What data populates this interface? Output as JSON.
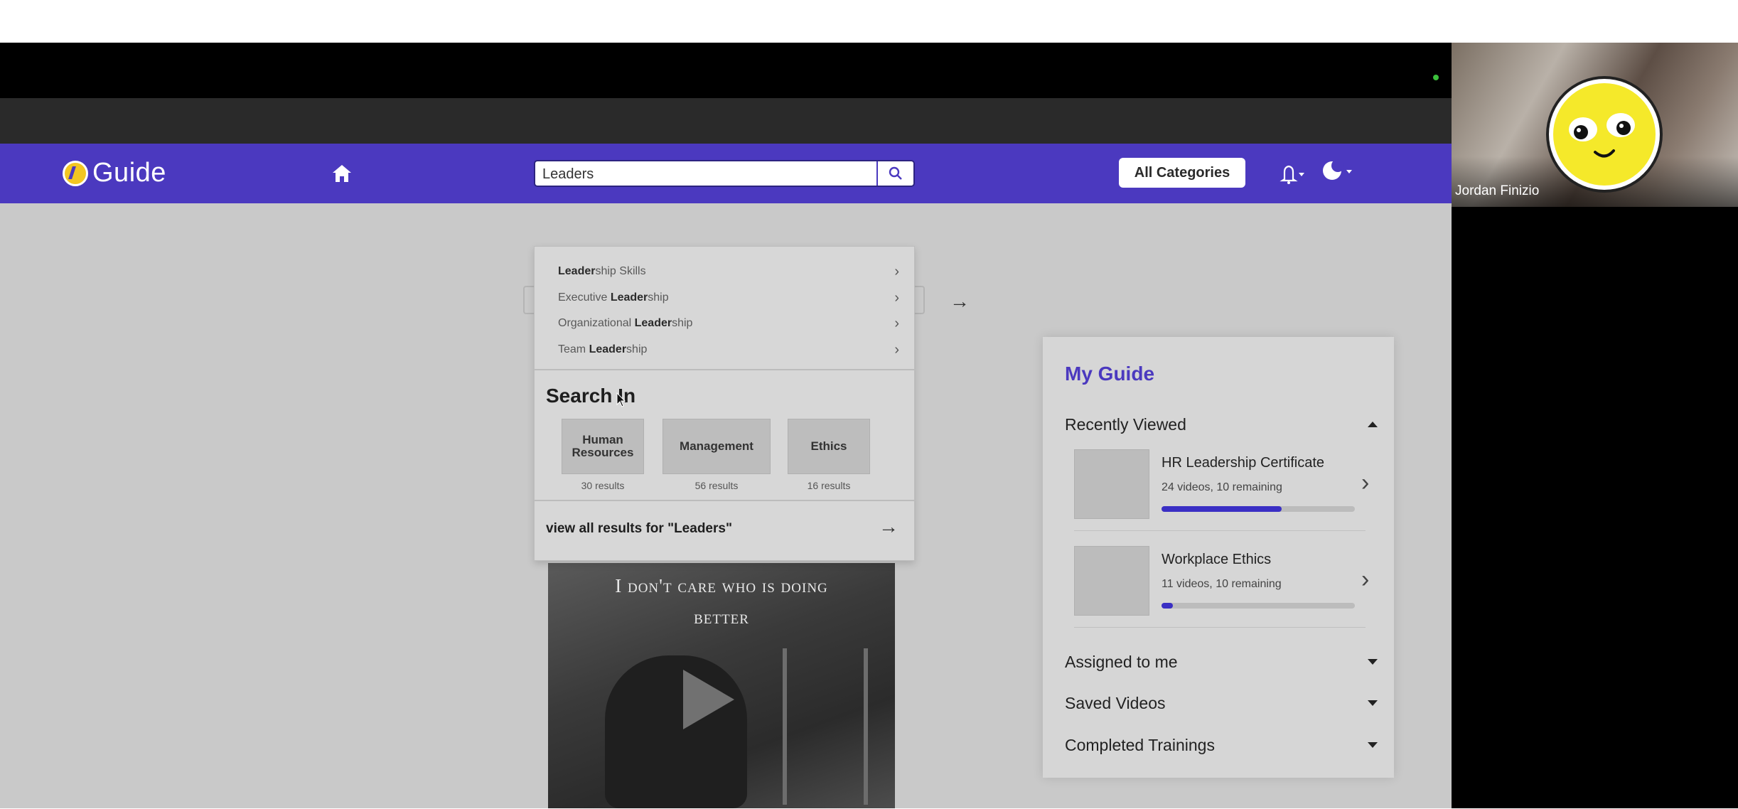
{
  "nav": {
    "logo_text": "Guide",
    "search_value": "Leaders",
    "all_categories_label": "All Categories"
  },
  "suggestions": [
    {
      "bold": "Leader",
      "rest": "ship Skills",
      "pre": ""
    },
    {
      "pre": "Executive ",
      "bold": "Leader",
      "rest": "ship"
    },
    {
      "pre": "Organizational ",
      "bold": "Leader",
      "rest": "ship"
    },
    {
      "pre": "Team ",
      "bold": "Leader",
      "rest": "ship"
    }
  ],
  "search_in": {
    "title": "Search In",
    "categories": [
      {
        "label_line1": "Human",
        "label_line2": "Resources",
        "count": "30 results"
      },
      {
        "label_line1": "Management",
        "label_line2": "",
        "count": "56 results"
      },
      {
        "label_line1": "Ethics",
        "label_line2": "",
        "count": "16 results"
      }
    ],
    "view_all": "view all results for \"Leaders\""
  },
  "video": {
    "caption_line1": "I don't care who is doing",
    "caption_line2": "better"
  },
  "my_guide": {
    "title": "My Guide",
    "recently_viewed": "Recently Viewed",
    "items": [
      {
        "title": "HR Leadership Certificate",
        "subtitle": "24 videos, 10 remaining",
        "progress": 0.62
      },
      {
        "title": "Workplace Ethics",
        "subtitle": "11 videos, 10 remaining",
        "progress": 0.06
      }
    ],
    "assigned": "Assigned to me",
    "saved": "Saved Videos",
    "completed": "Completed Trainings"
  },
  "participant": {
    "name": "Jordan Finizio"
  },
  "colors": {
    "brand": "#4b39bf",
    "progress": "#3a2fc4"
  }
}
